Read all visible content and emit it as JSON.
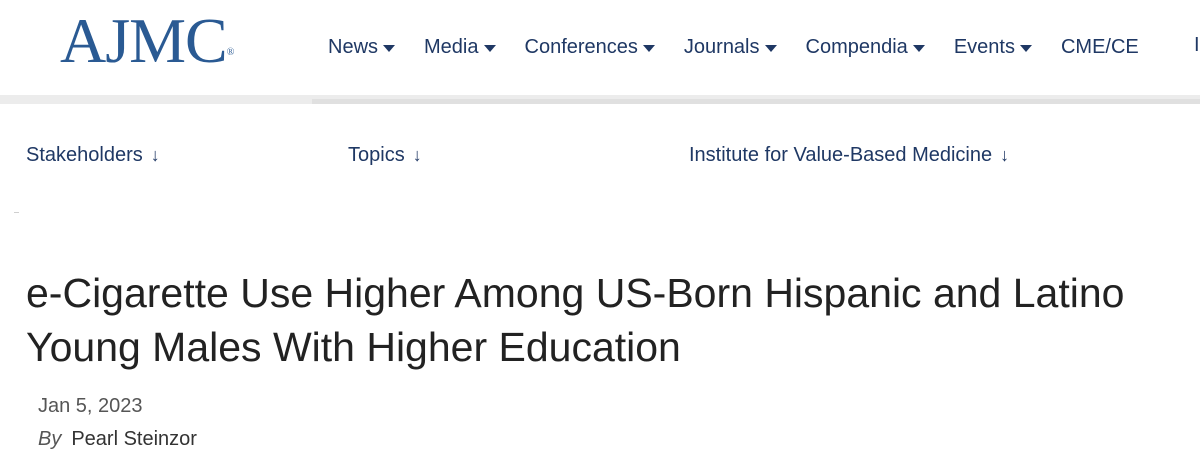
{
  "brand": {
    "logo": "AJMC",
    "registered": "®"
  },
  "nav": {
    "items": [
      {
        "label": "News",
        "caret": true
      },
      {
        "label": "Media",
        "caret": true
      },
      {
        "label": "Conferences",
        "caret": true
      },
      {
        "label": "Journals",
        "caret": true
      },
      {
        "label": "Compendia",
        "caret": true
      },
      {
        "label": "Events",
        "caret": true
      },
      {
        "label": "CME/CE",
        "caret": false
      }
    ],
    "cutoff": "I"
  },
  "subnav": {
    "stakeholders": "Stakeholders",
    "topics": "Topics",
    "institute": "Institute for Value-Based Medicine",
    "arrow": "↓"
  },
  "article": {
    "title_line1": "e-Cigarette Use Higher Among US-Born Hispanic and Latino",
    "title_line2": "Young Males With Higher Education",
    "date": "Jan 5, 2023",
    "by_label": "By",
    "author": "Pearl Steinzor"
  },
  "colors": {
    "brand": "#2a5a93",
    "nav": "#1f3864",
    "title": "#222222"
  }
}
